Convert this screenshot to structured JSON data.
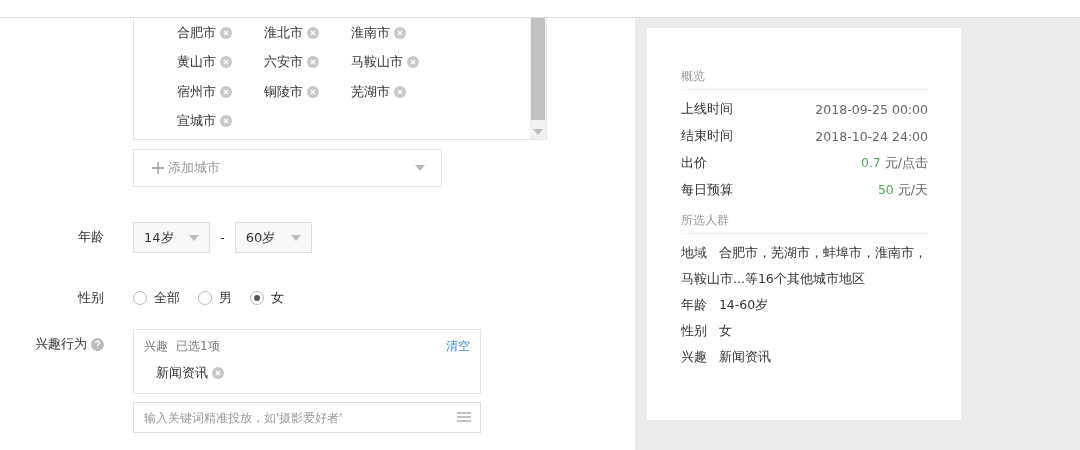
{
  "region": {
    "cities": [
      {
        "name": "合肥市"
      },
      {
        "name": "淮北市"
      },
      {
        "name": "淮南市"
      },
      {
        "name": "黄山市"
      },
      {
        "name": "六安市"
      },
      {
        "name": "马鞍山市"
      },
      {
        "name": "宿州市"
      },
      {
        "name": "铜陵市"
      },
      {
        "name": "芜湖市"
      },
      {
        "name": "宣城市"
      }
    ],
    "add_city": {
      "placeholder": "添加城市"
    }
  },
  "age": {
    "label": "年龄",
    "from": "14岁",
    "separator": "-",
    "to": "60岁"
  },
  "gender": {
    "label": "性别",
    "options": [
      {
        "label": "全部",
        "selected": false
      },
      {
        "label": "男",
        "selected": false
      },
      {
        "label": "女",
        "selected": true
      }
    ]
  },
  "interest": {
    "label": "兴趣行为",
    "category": "兴趣",
    "count": "已选1项",
    "clear": "清空",
    "tags": [
      "新闻资讯"
    ],
    "search": {
      "placeholder": "输入关键词精准投放，如'摄影爱好者'"
    }
  },
  "summary": {
    "overview_title": "概览",
    "overview": [
      {
        "kind": "plain",
        "label": "上线时间",
        "value": "2018-09-25 00:00"
      },
      {
        "kind": "plain",
        "label": "结束时间",
        "value": "2018-10-24 24:00"
      },
      {
        "kind": "amount",
        "label": "出价",
        "value": "0.7",
        "unit": "元/点击"
      },
      {
        "kind": "amount",
        "label": "每日预算",
        "value": "50",
        "unit": "元/天"
      }
    ],
    "audience_title": "所选人群",
    "audience": [
      {
        "label": "地域",
        "value": "合肥市，芜湖市，蚌埠市，淮南市，马鞍山市...等16个其他城市地区"
      },
      {
        "label": "年龄",
        "value": "14-60岁"
      },
      {
        "label": "性别",
        "value": "女"
      },
      {
        "label": "兴趣",
        "value": "新闻资讯"
      }
    ]
  }
}
